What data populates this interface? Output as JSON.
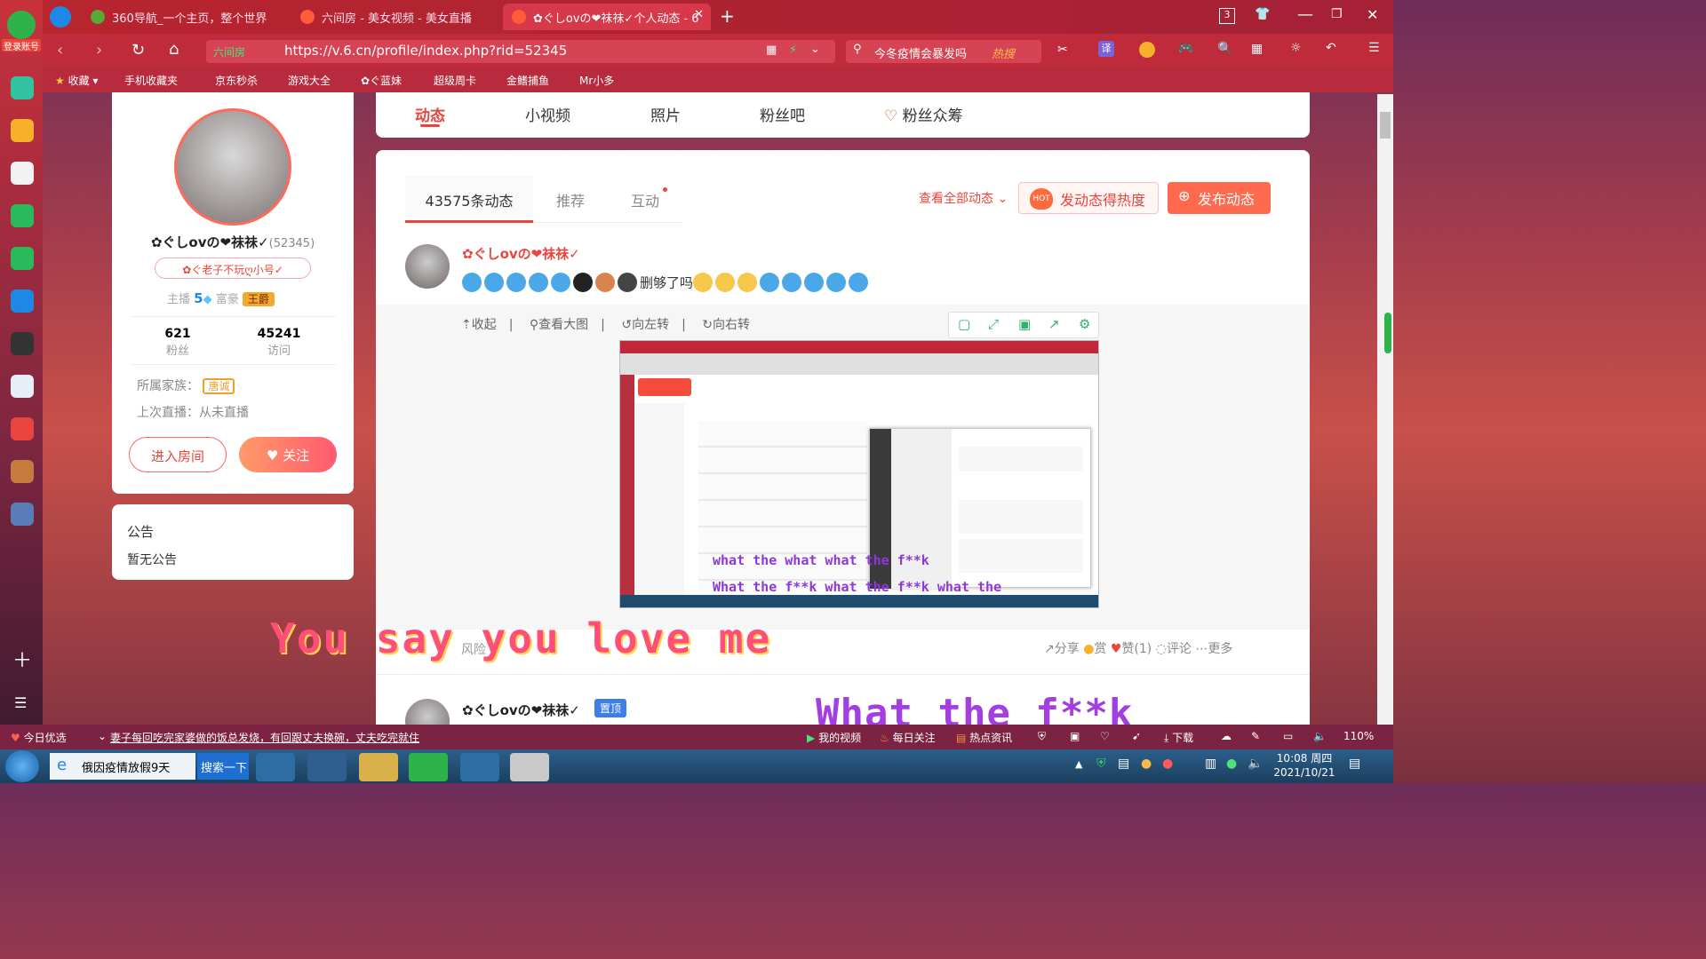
{
  "browser": {
    "tabs": [
      {
        "label": "360导航_一个主页，整个世界",
        "active": false
      },
      {
        "label": "六间房 - 美女视频 - 美女直播",
        "active": false
      },
      {
        "label": "✿ぐしovの❤祙祙✓个人动态 - 6",
        "active": true
      }
    ],
    "new_tab": "+",
    "tab_count": "3",
    "login_label": "登录账号",
    "url_prefix": "六间房",
    "url": "https://v.6.cn/profile/index.php?rid=52345",
    "search_text": "今冬疫情会暴发吗",
    "hot_label": "热搜",
    "translate_label": "译",
    "bookmarks": [
      "收藏",
      "手机收藏夹",
      "京东秒杀",
      "游戏大全",
      "✿ぐ蓝妹",
      "超级周卡",
      "金鳍捕鱼",
      "Mr小多"
    ]
  },
  "profile": {
    "nickname": "✿ぐしovの❤祙祙✓",
    "rid": "(52345)",
    "tagline": "✿ぐ老子不玩ღ小号✓",
    "anchor_label": "主播",
    "anchor_level": "5",
    "rich_label": "富豪",
    "rich_badge": "王爵",
    "fans_count": "621",
    "fans_label": "粉丝",
    "visits_count": "45241",
    "visits_label": "访问",
    "family_label": "所属家族：",
    "family_badge": "唐诚",
    "last_live": "上次直播：从未直播",
    "enter_room": "进入房间",
    "follow": "关注"
  },
  "notice": {
    "title": "公告",
    "body": "暂无公告"
  },
  "nav_tabs": [
    "动态",
    "小视频",
    "照片",
    "粉丝吧",
    "粉丝众筹"
  ],
  "feed": {
    "tabs": [
      "43575条动态",
      "推荐",
      "互动"
    ],
    "view_all": "查看全部动态",
    "hot_btn": "发动态得热度",
    "hot_badge": "HOT",
    "publish_btn": "发布动态",
    "post1": {
      "author": "✿ぐしovの❤祙祙✓",
      "text": "删够了吗",
      "toolbar": [
        "收起",
        "查看大图",
        "向左转",
        "向右转"
      ],
      "actions": [
        "分享",
        "赏",
        "赞(1)",
        "评论",
        "更多"
      ],
      "footer_left": "风险"
    },
    "post2": {
      "author": "✿ぐしovの❤祙祙✓",
      "pin": "置顶"
    }
  },
  "overlay_captions": {
    "big": "You say you love me",
    "wtf": "What the f**k",
    "small1": "what the what what the f**k",
    "small2": "What the f**k what the f**k what the"
  },
  "statusbar": {
    "left_label": "今日优选",
    "news": "妻子每回吃完家婆做的饭总发烧，有回跟丈夫换碗，丈夫吃完就住",
    "my_video": "我的视频",
    "daily": "每日关注",
    "hot_news": "热点资讯",
    "download": "下载",
    "zoom": "110%"
  },
  "taskbar": {
    "ie_item": "俄因疫情放假9天",
    "search_btn": "搜索一下",
    "time": "10:08 周四",
    "date": "2021/10/21"
  },
  "colors": {
    "accent": "#e8463c",
    "brand_red": "#c0283a",
    "follow": "#ff6b5a"
  }
}
